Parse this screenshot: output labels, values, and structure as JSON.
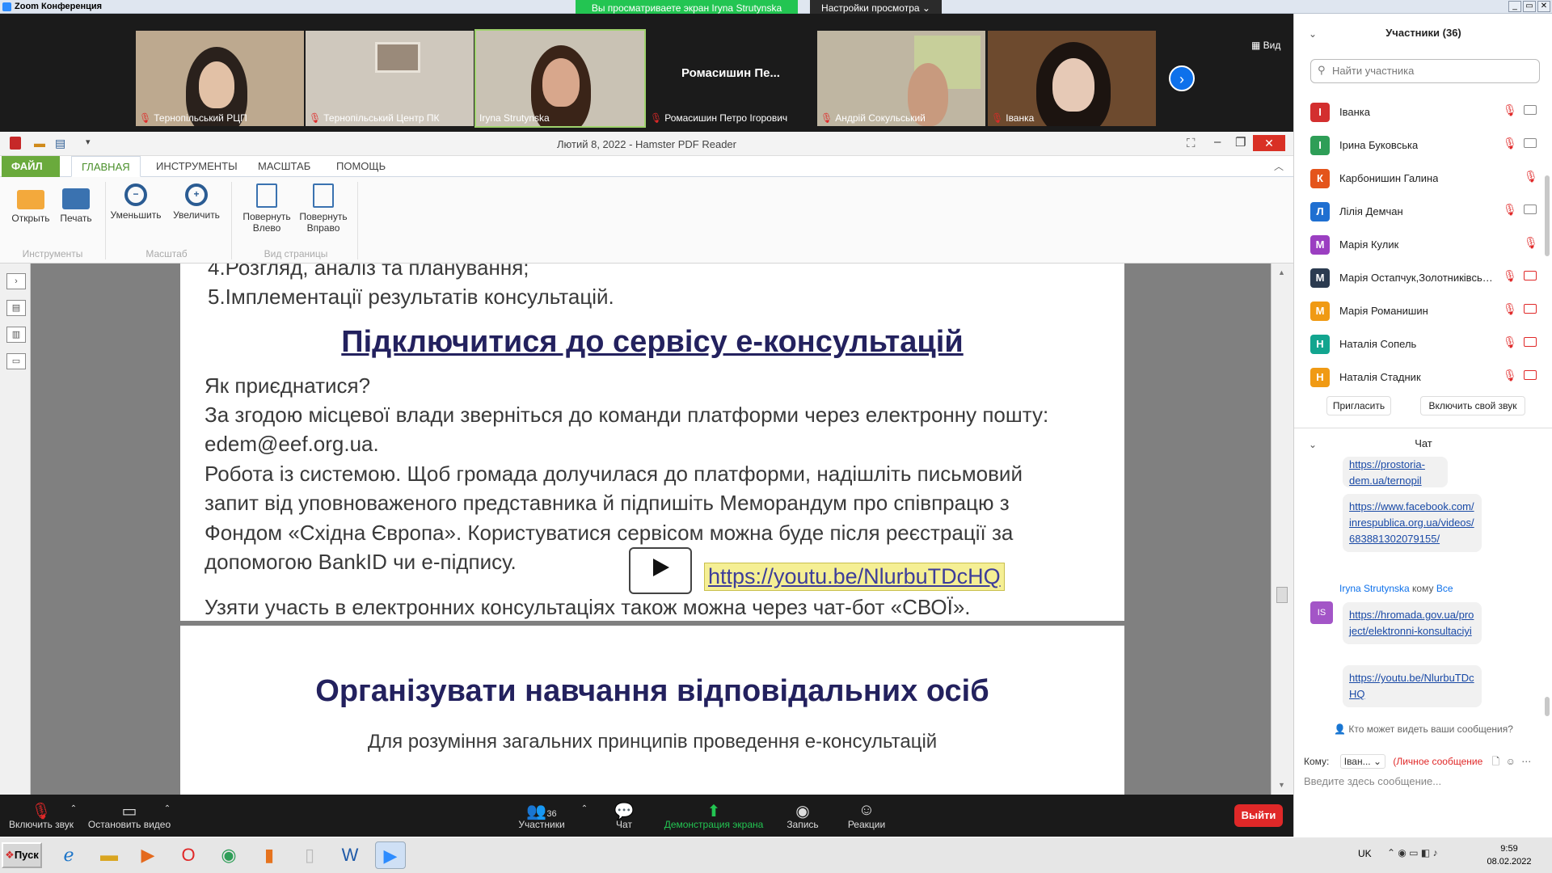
{
  "window": {
    "title": "Zoom Конференция",
    "share_banner": "Вы просматриваете экран Iryna Strutynska",
    "view_settings": "Настройки просмотра ⌄",
    "view_button": "▦ Вид"
  },
  "video_tiles": [
    {
      "name": "Тернопільський РЦП"
    },
    {
      "name": "Тернопільський Центр ПК"
    },
    {
      "name": "Iryna Strutynska"
    },
    {
      "title": "Ромасишин  Пе...",
      "name": "Ромасишин Петро Ігорович"
    },
    {
      "name": "Андрій Сокульський"
    },
    {
      "name": "Іванка"
    }
  ],
  "pdf": {
    "title": "Лютий 8, 2022 - Hamster PDF Reader",
    "tabs": [
      "ФАЙЛ",
      "ГЛАВНАЯ",
      "ИНСТРУМЕНТЫ",
      "МАСШТАБ",
      "ПОМОЩЬ"
    ],
    "buttons": {
      "open": "Открыть",
      "print": "Печать",
      "zoom_out": "Уменьшить",
      "zoom_in": "Увеличить",
      "rotate_left_1": "Повернуть",
      "rotate_left_2": "Влево",
      "rotate_right_1": "Повернуть",
      "rotate_right_2": "Вправо"
    },
    "groups": {
      "tools": "Инструменты",
      "scale": "Масштаб",
      "page_view": "Вид страницы"
    },
    "page1": {
      "item4": "4.Розгляд, аналіз та планування;",
      "item5": "5.Імплементації результатів консультацій.",
      "heading": "Підключитися до сервісу е-консультацій",
      "line1": "Як приєднатися?",
      "line2": "За згодою місцевої влади зверніться до команди платформи через електронну пошту:",
      "line3": "edem@eef.org.ua.",
      "line4": "Робота із системою.  Щоб громада долучилася до платформи, надішліть письмовий",
      "line5": "запит від уповноваженого представника й підпишіть Меморандум про співпрацю з",
      "line6": "Фондом «Східна Європа». Користуватися сервісом можна буде після реєстрації за",
      "line7": "допомогою BankID чи е-підпису.",
      "link": "https://youtu.be/NlurbuTDcHQ",
      "line8": "Узяти участь в електронних консультаціях також можна через чат-бот «СВОЇ»."
    },
    "page2": {
      "heading": "Організувати навчання відповідальних осіб",
      "line1": "Для розуміння загальних принципів проведення е-консультацій"
    }
  },
  "participants_panel": {
    "title": "Участники (36)",
    "search_placeholder": "Найти участника",
    "participants": [
      {
        "initial": "І",
        "name": "Іванка",
        "color": "#d32f2f",
        "cam": "on"
      },
      {
        "initial": "І",
        "name": "Ірина Буковська",
        "color": "#2e9e57",
        "cam": "on"
      },
      {
        "initial": "К",
        "name": "Карбонишин Галина",
        "color": "#e4541b",
        "cam": "none"
      },
      {
        "initial": "Л",
        "name": "Лілія Демчан",
        "color": "#1f6fd1",
        "cam": "on"
      },
      {
        "initial": "М",
        "name": "Марія Кулик",
        "color": "#9b3fc1",
        "cam": "none"
      },
      {
        "initial": "М",
        "name": "Марія Остапчук,Золотниківськ...",
        "color": "#2b3b50",
        "cam": "off"
      },
      {
        "initial": "М",
        "name": "Марія Романишин",
        "color": "#f09a14",
        "cam": "off"
      },
      {
        "initial": "Н",
        "name": "Наталія Сопель",
        "color": "#12a58f",
        "cam": "off"
      },
      {
        "initial": "Н",
        "name": "Наталія Стадник",
        "color": "#f09a14",
        "cam": "off"
      }
    ],
    "invite_button": "Пригласить",
    "unmute_button": "Включить свой звук"
  },
  "chat_panel": {
    "title": "Чат",
    "messages_top": [
      "https://prostoria-dem.ua/ternopil"
    ],
    "message_fb": "https://www.facebook.com/inrespublica.org.ua/videos/683881302079155/",
    "sender": "Iryna Strutynska",
    "sender_to": "кому",
    "sender_all": "Все",
    "sender_avatar": "IS",
    "message_hromada": "https://hromada.gov.ua/project/elektronni-konsultaciyi",
    "message_youtube": "https://youtu.be/NlurbuTDcHQ",
    "who_can_see": "Кто может видеть ваши сообщения?",
    "to_label": "Кому:",
    "to_value": "Іван...",
    "private_label": "(Личное сообщение",
    "input_placeholder": "Введите здесь сообщение..."
  },
  "toolbar": {
    "unmute": "Включить звук",
    "stop_video": "Остановить видео",
    "participants": "Участники",
    "participants_count": "36",
    "chat": "Чат",
    "share": "Демонстрация экрана",
    "record": "Запись",
    "reactions": "Реакции",
    "leave": "Выйти"
  },
  "taskbar": {
    "start": "Пуск",
    "lang": "UK",
    "time": "9:59",
    "date": "08.02.2022"
  }
}
